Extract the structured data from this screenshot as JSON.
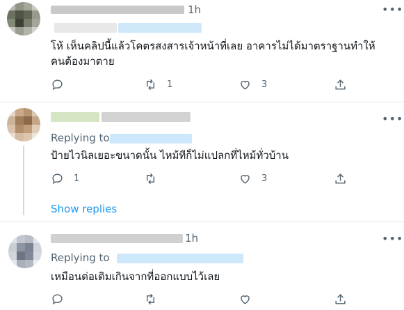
{
  "tweets": [
    {
      "time": "1h",
      "text_line1": "โห้ เห็นคลิปนี้แล้วโคตรสงสารเจ้าหน้าที่เลย อาคารไม่ได้มาตราฐานทำให้",
      "text_line2": "คนต้องมาตาย",
      "replies": "",
      "retweets": "1",
      "likes": "3"
    },
    {
      "replying_to": "Replying to",
      "text_line1": "ป้ายไวนิลเยอะขนาดนั้น ไหม้ทีก็ไม่แปลกที่ไหม้ทั่วบ้าน",
      "replies": "1",
      "retweets": "",
      "likes": "3",
      "show_replies": "Show replies"
    },
    {
      "time": "1h",
      "replying_to": "Replying to",
      "text_line1": "เหมือนต่อเติมเกินจากที่ออกแบบไว้เลย"
    }
  ],
  "icons": {
    "more": "more-icon",
    "reply": "reply-icon",
    "retweet": "retweet-icon",
    "like": "heart-icon",
    "share": "share-icon"
  },
  "colors": {
    "link": "#1d9bf0",
    "secondary": "#536471",
    "divider": "#e1e8ed"
  }
}
